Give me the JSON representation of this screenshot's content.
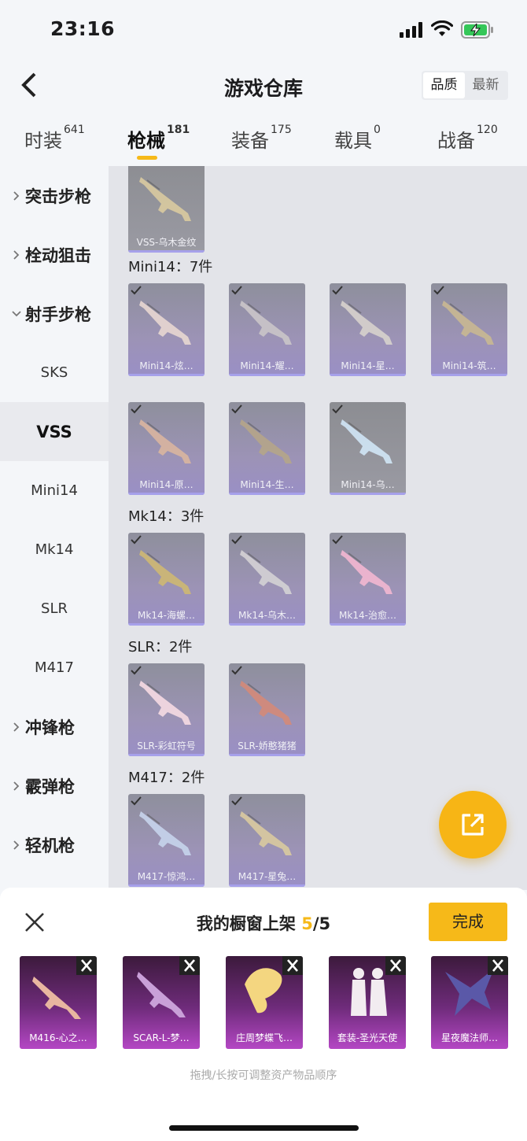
{
  "status_bar": {
    "time": "23:16"
  },
  "header": {
    "title": "游戏仓库",
    "sort_options": [
      "品质",
      "最新"
    ],
    "sort_active": 0
  },
  "tabs": [
    {
      "label": "时装",
      "count": "641"
    },
    {
      "label": "枪械",
      "count": "181"
    },
    {
      "label": "装备",
      "count": "175"
    },
    {
      "label": "载具",
      "count": "0"
    },
    {
      "label": "战备",
      "count": "120"
    }
  ],
  "sidebar": {
    "items": [
      {
        "label": "突击步枪",
        "type": "category",
        "expanded": false
      },
      {
        "label": "栓动狙击",
        "type": "category",
        "expanded": false
      },
      {
        "label": "射手步枪",
        "type": "category",
        "expanded": true
      },
      {
        "label": "SKS",
        "type": "sub"
      },
      {
        "label": "VSS",
        "type": "sub",
        "active": true
      },
      {
        "label": "Mini14",
        "type": "sub"
      },
      {
        "label": "Mk14",
        "type": "sub"
      },
      {
        "label": "SLR",
        "type": "sub"
      },
      {
        "label": "M417",
        "type": "sub"
      },
      {
        "label": "冲锋枪",
        "type": "category",
        "expanded": false
      },
      {
        "label": "霰弹枪",
        "type": "category",
        "expanded": false
      },
      {
        "label": "轻机枪",
        "type": "category",
        "expanded": false
      }
    ]
  },
  "main": {
    "sections": [
      {
        "label": "",
        "items": [
          {
            "name": "VSS-乌木金纹",
            "style": "grey"
          }
        ]
      },
      {
        "label": "Mini14：7件",
        "items": [
          {
            "name": "Mini14-炫…",
            "style": "purple"
          },
          {
            "name": "Mini14-耀…",
            "style": "purple"
          },
          {
            "name": "Mini14-星…",
            "style": "purple"
          },
          {
            "name": "Mini14-筑…",
            "style": "purple"
          },
          {
            "name": "Mini14-原…",
            "style": "purple"
          },
          {
            "name": "Mini14-生…",
            "style": "purple"
          },
          {
            "name": "Mini14-乌…",
            "style": "grey"
          }
        ]
      },
      {
        "label": "Mk14：3件",
        "items": [
          {
            "name": "Mk14-海螺…",
            "style": "purple"
          },
          {
            "name": "Mk14-乌木…",
            "style": "purple"
          },
          {
            "name": "Mk14-治愈…",
            "style": "purple"
          }
        ]
      },
      {
        "label": "SLR：2件",
        "items": [
          {
            "name": "SLR-彩虹符号",
            "style": "purple"
          },
          {
            "name": "SLR-娇憨猪猪",
            "style": "purple"
          }
        ]
      },
      {
        "label": "M417：2件",
        "items": [
          {
            "name": "M417-惊鸿…",
            "style": "purple"
          },
          {
            "name": "M417-星兔…",
            "style": "purple"
          }
        ]
      }
    ]
  },
  "panel": {
    "title": "我的橱窗上架",
    "count": "5",
    "total": "/5",
    "done_label": "完成",
    "items": [
      "M416-心之…",
      "SCAR-L-梦…",
      "庄周梦蝶飞…",
      "套装-圣光天使",
      "星夜魔法师…"
    ],
    "hint": "拖拽/长按可调整资产物品顺序"
  },
  "colors": {
    "accent": "#f6b919",
    "purple_card": "#9a8fc6",
    "showcase_card": "#b447c4"
  },
  "icons": [
    "back-icon",
    "signal-icon",
    "wifi-icon",
    "battery-icon",
    "chevron-right-icon",
    "chevron-down-icon",
    "check-icon",
    "share-icon",
    "close-icon"
  ]
}
